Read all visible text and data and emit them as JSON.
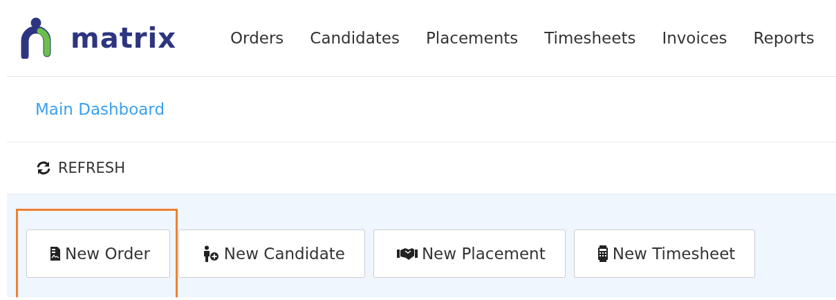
{
  "logo": {
    "text": "matrix"
  },
  "nav": [
    {
      "label": "Orders"
    },
    {
      "label": "Candidates"
    },
    {
      "label": "Placements"
    },
    {
      "label": "Timesheets"
    },
    {
      "label": "Invoices"
    },
    {
      "label": "Reports"
    }
  ],
  "breadcrumb": {
    "label": "Main Dashboard"
  },
  "toolbar": {
    "refresh": "REFRESH"
  },
  "actions": [
    {
      "kind": "order",
      "label": "New Order",
      "highlighted": true
    },
    {
      "kind": "candidate",
      "label": "New Candidate",
      "highlighted": false
    },
    {
      "kind": "placement",
      "label": "New Placement",
      "highlighted": false
    },
    {
      "kind": "timesheet",
      "label": "New Timesheet",
      "highlighted": false
    }
  ]
}
